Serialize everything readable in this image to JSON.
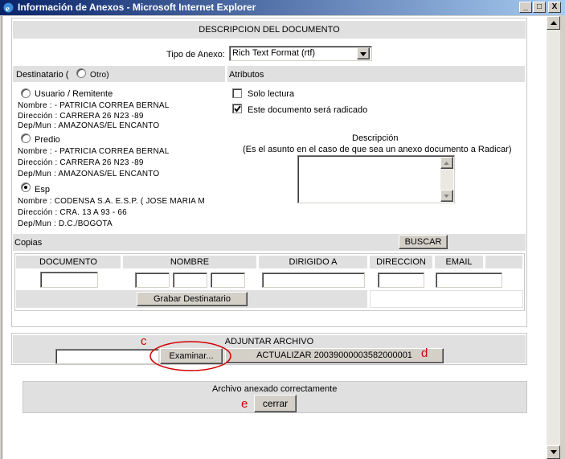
{
  "window": {
    "title": "Información de Anexos - Microsoft Internet Explorer",
    "buttons": {
      "minimize": "_",
      "maximize": "□",
      "close": "X"
    }
  },
  "descripcion": {
    "header": "DESCRIPCION DEL DOCUMENTO",
    "tipo_anexo_label": "Tipo de Anexo:",
    "tipo_anexo_value": "Rich Text Format (rtf)"
  },
  "destinatario": {
    "label": "Destinatario (",
    "otro_label": "Otro)",
    "usuario": {
      "label": "Usuario / Remitente",
      "nombre": "Nombre : - PATRICIA CORREA BERNAL",
      "direccion": "Dirección : CARRERA 26 N23 -89",
      "depmun": "Dep/Mun : AMAZONAS/EL ENCANTO"
    },
    "predio": {
      "label": "Predio",
      "nombre": "Nombre : - PATRICIA CORREA BERNAL",
      "direccion": "Dirección : CARRERA 26 N23 -89",
      "depmun": "Dep/Mun : AMAZONAS/EL ENCANTO"
    },
    "esp": {
      "label": "Esp",
      "nombre": "Nombre : CODENSA S.A. E.S.P. ( JOSE MARIA M",
      "direccion": "Dirección : CRA. 13 A 93 - 66",
      "depmun": "Dep/Mun : D.C./BOGOTA"
    }
  },
  "atributos": {
    "header": "Atributos",
    "solo_lectura": "Solo lectura",
    "radicado": "Este documento será radicado",
    "descripcion_title": "Descripción",
    "descripcion_hint": "(Es el asunto en el caso de que sea un anexo documento a Radicar)"
  },
  "copias": {
    "label": "Copias",
    "buscar": "BUSCAR",
    "columns": [
      "DOCUMENTO",
      "NOMBRE",
      "DIRIGIDO A",
      "DIRECCION",
      "EMAIL"
    ],
    "grabar": "Grabar Destinatario"
  },
  "adjuntar": {
    "header": "ADJUNTAR ARCHIVO",
    "examinar": "Examinar...",
    "actualizar": "ACTUALIZAR 20039000003582000001"
  },
  "resultado": {
    "message": "Archivo anexado correctamente",
    "cerrar": "cerrar"
  },
  "annotations": {
    "c": "c",
    "d": "d",
    "e": "e"
  },
  "colors": {
    "annotation_red": "#d00000",
    "titlebar": "#0a246a",
    "section_gray": "#e0e0e0"
  }
}
